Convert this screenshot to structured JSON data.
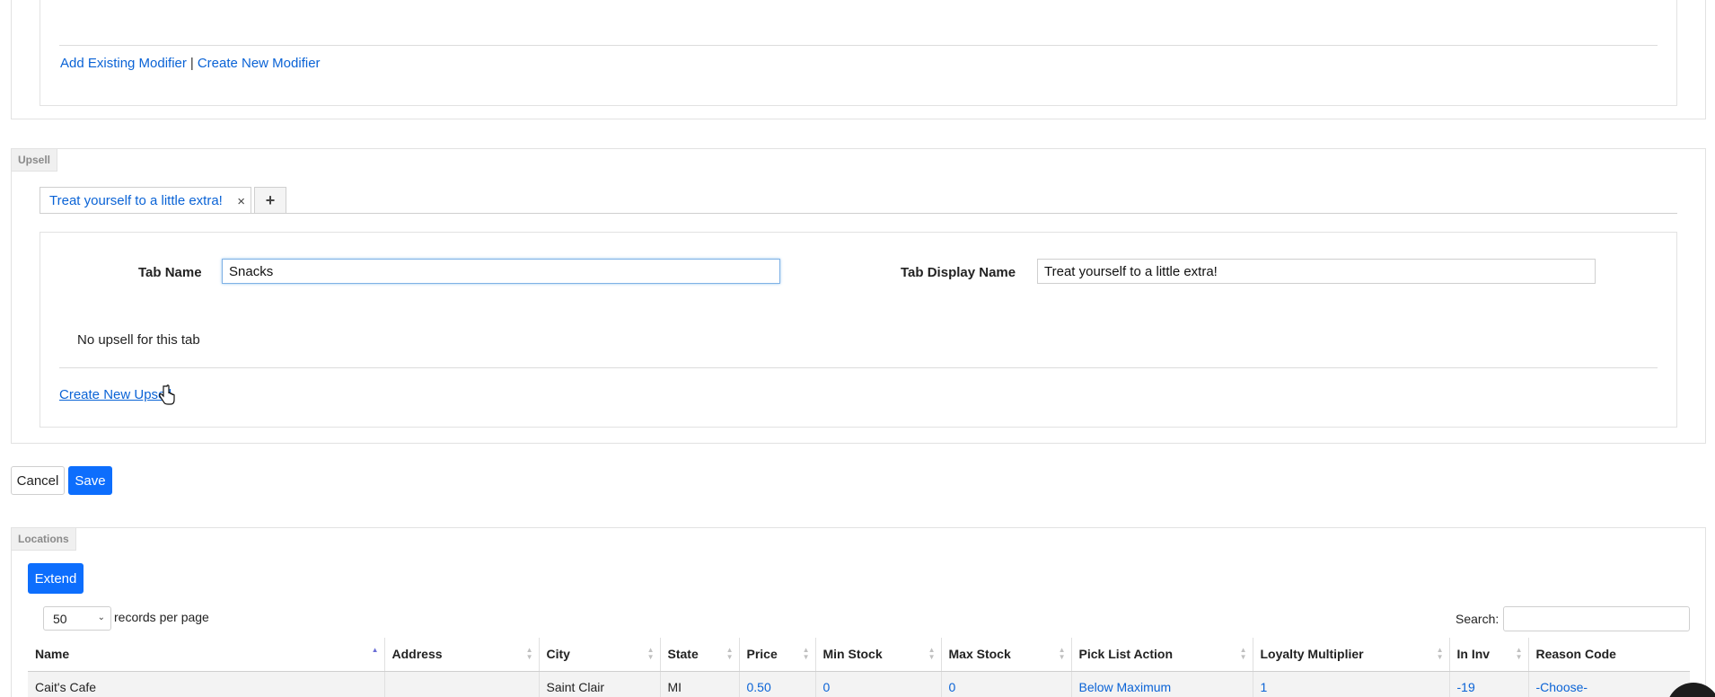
{
  "modifiers": {
    "add_existing": "Add Existing Modifier",
    "separator": "|",
    "create_new": "Create New Modifier"
  },
  "upsell": {
    "legend": "Upsell",
    "tab_label": "Treat yourself to a little extra!",
    "tab_close": "×",
    "tab_add": "+",
    "tab_name_label": "Tab Name",
    "tab_name_value": "Snacks",
    "tab_display_label": "Tab Display Name",
    "tab_display_value": "Treat yourself to a little extra!",
    "empty_message": "No upsell for this tab",
    "create_link": "Create New Upsell"
  },
  "actions": {
    "cancel": "Cancel",
    "save": "Save"
  },
  "locations": {
    "legend": "Locations",
    "extend": "Extend",
    "page_size": "50",
    "records_label": "records per page",
    "search_label": "Search:",
    "search_value": "",
    "columns": [
      "Name",
      "Address",
      "City",
      "State",
      "Price",
      "Min Stock",
      "Max Stock",
      "Pick List Action",
      "Loyalty Multiplier",
      "In Inv",
      "Reason Code"
    ],
    "rows": [
      {
        "name": "Cait's Cafe",
        "address": "",
        "city": "Saint Clair",
        "state": "MI",
        "price": "0.50",
        "min_stock": "0",
        "max_stock": "0",
        "pick_list_action": "Below Maximum",
        "loyalty_multiplier": "1",
        "in_inv": "-19",
        "reason_code": "-Choose-"
      }
    ]
  },
  "colors": {
    "link": "#0a63d6",
    "primary": "#0d6efd",
    "border": "#e2e2e2"
  }
}
